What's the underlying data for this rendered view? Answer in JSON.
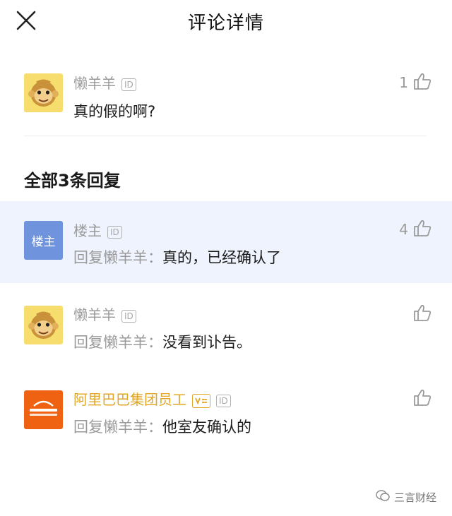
{
  "header": {
    "title": "评论详情",
    "close_icon": "close-icon"
  },
  "main_comment": {
    "author": "懒羊羊",
    "id_badge": "ID",
    "text": "真的假的啊?",
    "likes": "1"
  },
  "replies_section": {
    "title": "全部3条回复"
  },
  "replies": [
    {
      "author": "楼主",
      "avatar_text": "楼主",
      "id_badge": "ID",
      "prefix": "回复懒羊羊：",
      "text": "真的，已经确认了",
      "likes": "4",
      "highlighted": true
    },
    {
      "author": "懒羊羊",
      "id_badge": "ID",
      "prefix": "回复懒羊羊：",
      "text": "没看到讣告。",
      "likes": ""
    },
    {
      "author": "阿里巴巴集团员工",
      "id_badge": "ID",
      "prefix": "回复懒羊羊：",
      "text": "他室友确认的",
      "likes": ""
    }
  ],
  "colors": {
    "highlight_bg": "#eef3fd",
    "gold": "#e0a624",
    "muted": "#9a9a9a"
  },
  "watermark": {
    "text": "三言财经"
  }
}
